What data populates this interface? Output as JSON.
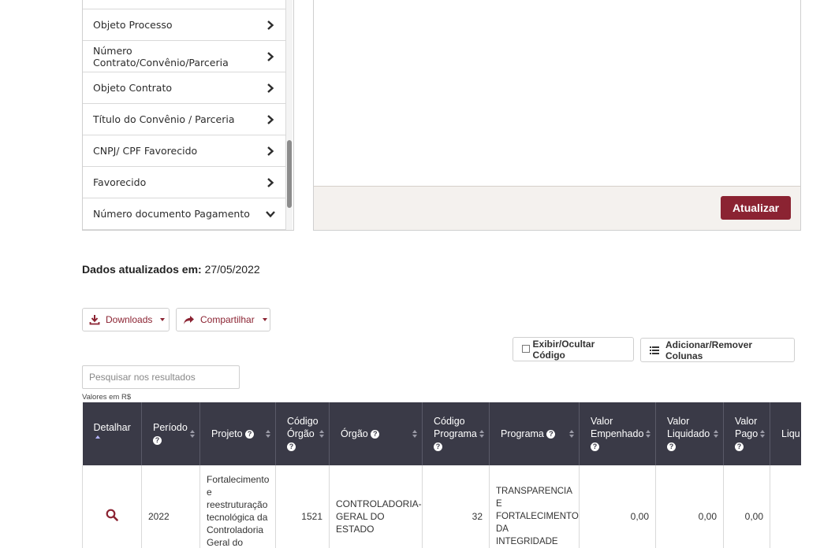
{
  "filters": {
    "items": [
      {
        "label": "",
        "icon": "chevron-right-icon"
      },
      {
        "label": "Objeto Processo",
        "icon": "chevron-right-icon"
      },
      {
        "label": "Número Contrato/Convênio/Parceria",
        "icon": "chevron-right-icon"
      },
      {
        "label": "Objeto Contrato",
        "icon": "chevron-right-icon"
      },
      {
        "label": "Título do Convênio / Parceria",
        "icon": "chevron-right-icon"
      },
      {
        "label": "CNPJ/ CPF Favorecido",
        "icon": "chevron-right-icon"
      },
      {
        "label": "Favorecido",
        "icon": "chevron-right-icon"
      },
      {
        "label": "Número documento Pagamento",
        "icon": "chevron-down-icon"
      }
    ]
  },
  "results": {
    "refresh_label": "Atualizar"
  },
  "updated": {
    "label": "Dados atualizados em:",
    "date": "27/05/2022"
  },
  "toolbar": {
    "downloads_label": "Downloads",
    "share_label": "Compartilhar",
    "toggle_code_label": "Exibir/Ocultar Código",
    "columns_label": "Adicionar/Remover Colunas"
  },
  "search": {
    "placeholder": "Pesquisar nos resultados"
  },
  "currency_note": "Valores em R$",
  "table": {
    "headers": {
      "detalhar": "Detalhar",
      "periodo": "Período",
      "projeto": "Projeto",
      "codigo_orgao_1": "Código",
      "codigo_orgao_2": "Órgão",
      "orgao": "Órgão",
      "codigo_programa_1": "Código",
      "codigo_programa_2": "Programa",
      "programa": "Programa",
      "valor_empenhado_1": "Valor",
      "valor_empenhado_2": "Empenhado",
      "valor_liquidado_1": "Valor",
      "valor_liquidado_2": "Liquidado",
      "valor_pago_1": "Valor",
      "valor_pago_2": "Pago",
      "liquido": "Liqu"
    },
    "row": {
      "periodo": "2022",
      "projeto": "Fortalecimento e reestruturação tecnológica da Controladoria Geral do",
      "codigo_orgao": "1521",
      "orgao": "CONTROLADORIA-GERAL DO ESTADO",
      "codigo_programa": "32",
      "programa": "TRANSPARENCIA E FORTALECIMENTO DA INTEGRIDADE",
      "valor_empenhado": "0,00",
      "valor_liquidado": "0,00",
      "valor_pago": "0,00"
    }
  },
  "colors": {
    "accent": "#8b2332",
    "header_bg": "#3a3a47"
  }
}
